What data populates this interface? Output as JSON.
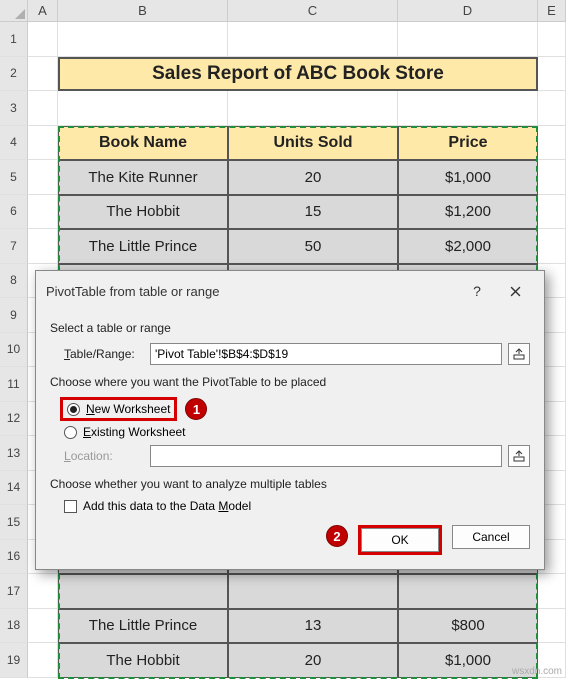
{
  "columns": [
    "A",
    "B",
    "C",
    "D",
    "E"
  ],
  "rows": [
    "1",
    "2",
    "3",
    "4",
    "5",
    "6",
    "7",
    "8",
    "9",
    "10",
    "11",
    "12",
    "13",
    "14",
    "15",
    "16",
    "17",
    "18",
    "19"
  ],
  "title": "Sales Report of ABC Book Store",
  "headers": {
    "book": "Book Name",
    "units": "Units Sold",
    "price": "Price"
  },
  "data_top": [
    {
      "book": "The Kite Runner",
      "units": "20",
      "price": "$1,000"
    },
    {
      "book": "The Hobbit",
      "units": "15",
      "price": "$1,200"
    },
    {
      "book": "The Little Prince",
      "units": "50",
      "price": "$2,000"
    }
  ],
  "data_bottom": [
    {
      "book": "The Little Prince",
      "units": "13",
      "price": "$800"
    },
    {
      "book": "The Hobbit",
      "units": "20",
      "price": "$1,000"
    }
  ],
  "dialog": {
    "title": "PivotTable from table or range",
    "help": "?",
    "sec1": "Select a table or range",
    "table_range_label": "Table/Range:",
    "table_range_value": "'Pivot Table'!$B$4:$D$19",
    "sec2": "Choose where you want the PivotTable to be placed",
    "radio_new_pre": "N",
    "radio_new_post": "ew Worksheet",
    "radio_exist_pre": "E",
    "radio_exist_post": "xisting Worksheet",
    "location_label": "Location:",
    "location_value": "",
    "sec3": "Choose whether you want to analyze multiple tables",
    "check_pre": "Add this data to the Data ",
    "check_u": "M",
    "check_post": "odel",
    "ok": "OK",
    "cancel": "Cancel",
    "callout1": "1",
    "callout2": "2"
  },
  "watermark": "wsxdn.com"
}
